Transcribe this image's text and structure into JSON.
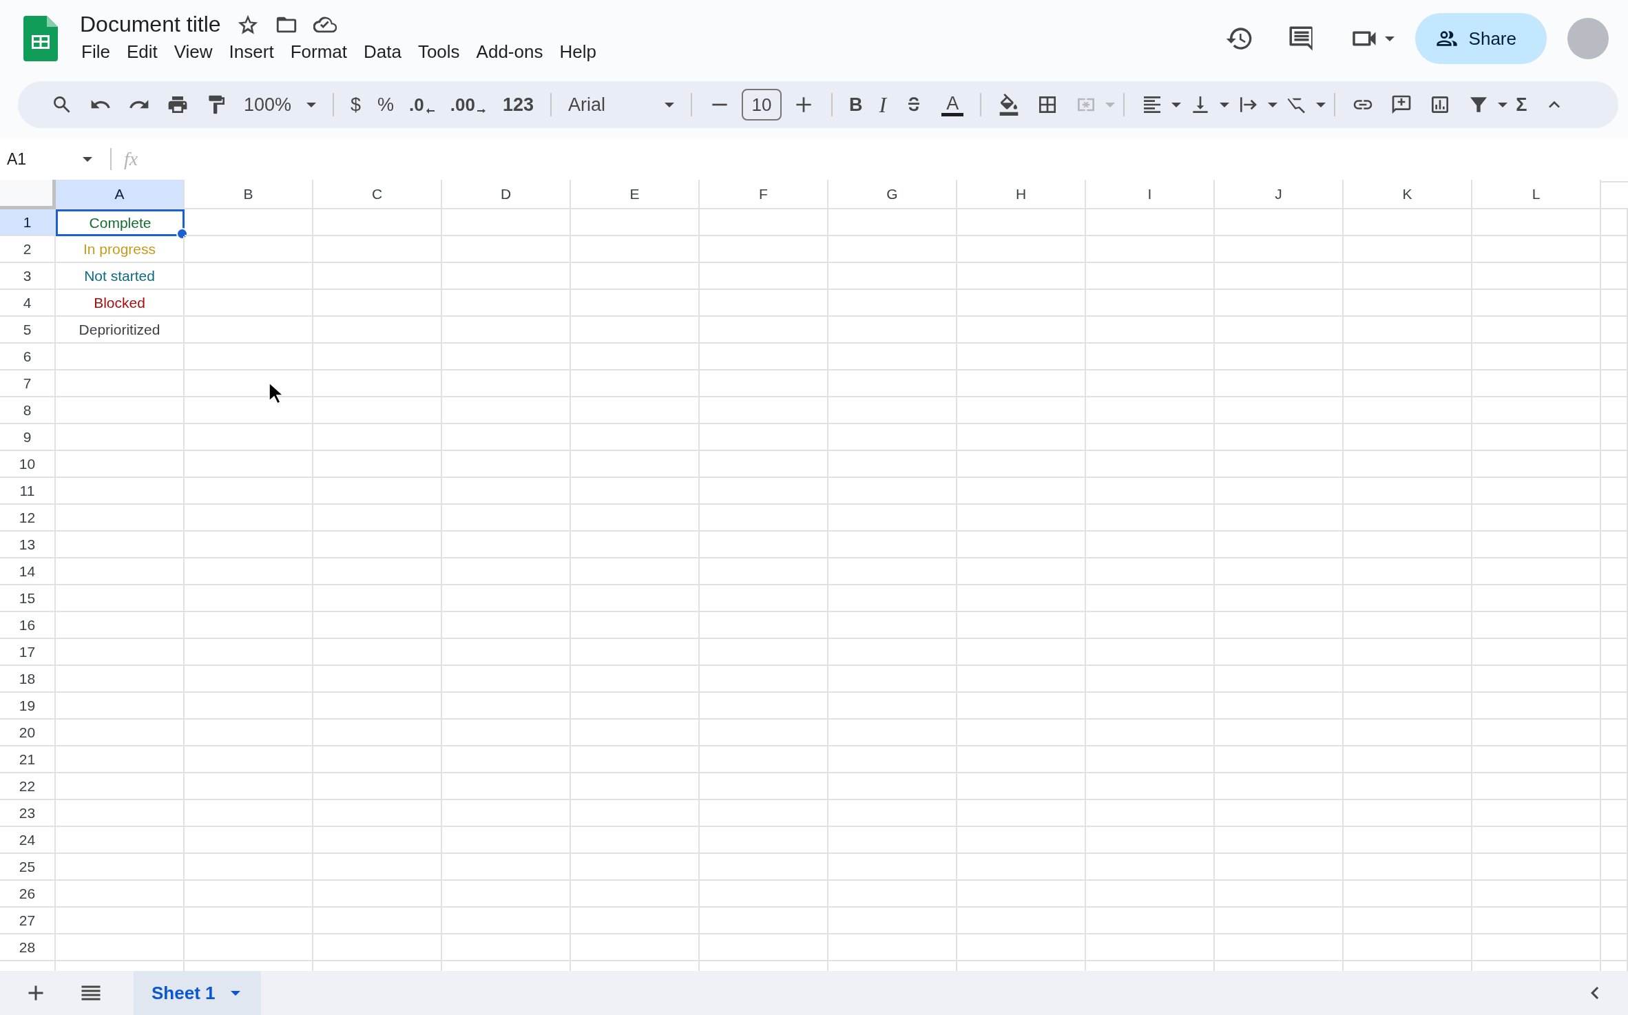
{
  "document": {
    "title": "Document title"
  },
  "menu": [
    "File",
    "Edit",
    "View",
    "Insert",
    "Format",
    "Data",
    "Tools",
    "Add-ons",
    "Help"
  ],
  "share": {
    "label": "Share"
  },
  "toolbar": {
    "zoom": "100%",
    "currency": "$",
    "percent": "%",
    "decrease_decimal": ".0",
    "increase_decimal": ".00",
    "number_format": "123",
    "font": "Arial",
    "font_size": "10",
    "bold": "B",
    "italic": "I",
    "text_color": "A",
    "functions": "Σ"
  },
  "formula_bar": {
    "cell_reference": "A1",
    "label": "fx"
  },
  "grid": {
    "columns": [
      {
        "label": "A",
        "selected": true
      },
      {
        "label": "B",
        "selected": false
      },
      {
        "label": "C",
        "selected": false
      },
      {
        "label": "D",
        "selected": false
      },
      {
        "label": "E",
        "selected": false
      },
      {
        "label": "F",
        "selected": false
      },
      {
        "label": "G",
        "selected": false
      },
      {
        "label": "H",
        "selected": false
      },
      {
        "label": "I",
        "selected": false
      },
      {
        "label": "J",
        "selected": false
      },
      {
        "label": "K",
        "selected": false
      },
      {
        "label": "L",
        "selected": false
      }
    ],
    "rows": [
      {
        "label": "1",
        "selected": true,
        "cells": [
          {
            "text": "Complete",
            "color": "#146c2e",
            "active": true
          }
        ]
      },
      {
        "label": "2",
        "selected": false,
        "cells": [
          {
            "text": "In progress",
            "color": "#c89a1c",
            "active": false
          }
        ]
      },
      {
        "label": "3",
        "selected": false,
        "cells": [
          {
            "text": "Not started",
            "color": "#0b6b82",
            "active": false
          }
        ]
      },
      {
        "label": "4",
        "selected": false,
        "cells": [
          {
            "text": "Blocked",
            "color": "#a50e0e",
            "active": false
          }
        ]
      },
      {
        "label": "5",
        "selected": false,
        "cells": [
          {
            "text": "Deprioritized",
            "color": "#3c4043",
            "active": false
          }
        ]
      },
      {
        "label": "6",
        "selected": false
      },
      {
        "label": "7",
        "selected": false
      },
      {
        "label": "8",
        "selected": false
      },
      {
        "label": "9",
        "selected": false
      },
      {
        "label": "10",
        "selected": false
      },
      {
        "label": "11",
        "selected": false
      },
      {
        "label": "12",
        "selected": false
      },
      {
        "label": "13",
        "selected": false
      },
      {
        "label": "14",
        "selected": false
      },
      {
        "label": "15",
        "selected": false
      },
      {
        "label": "16",
        "selected": false
      },
      {
        "label": "17",
        "selected": false
      },
      {
        "label": "18",
        "selected": false
      },
      {
        "label": "19",
        "selected": false
      },
      {
        "label": "20",
        "selected": false
      },
      {
        "label": "21",
        "selected": false
      },
      {
        "label": "22",
        "selected": false
      },
      {
        "label": "23",
        "selected": false
      },
      {
        "label": "24",
        "selected": false
      },
      {
        "label": "25",
        "selected": false
      },
      {
        "label": "26",
        "selected": false
      },
      {
        "label": "27",
        "selected": false
      },
      {
        "label": "28",
        "selected": false
      }
    ]
  },
  "sheets": [
    {
      "label": "Sheet 1",
      "selected": true
    }
  ]
}
